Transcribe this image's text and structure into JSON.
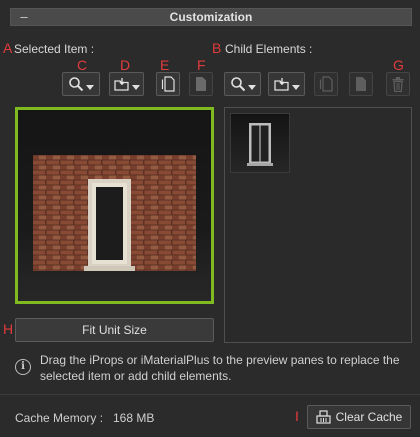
{
  "panel": {
    "title": "Customization",
    "collapse_glyph": "–"
  },
  "markers": {
    "a": "A",
    "b": "B",
    "c": "C",
    "d": "D",
    "e": "E",
    "f": "F",
    "g": "G",
    "h": "H",
    "i": "I"
  },
  "selected": {
    "label": "Selected Item :",
    "toolbar": [
      {
        "icon": "magnifier-icon",
        "dropdown": true,
        "enabled": true
      },
      {
        "icon": "folder-load-icon",
        "dropdown": true,
        "enabled": true
      },
      {
        "icon": "duplicate-icon",
        "dropdown": false,
        "enabled": true
      },
      {
        "icon": "document-icon",
        "dropdown": false,
        "enabled": false
      }
    ],
    "fit_button": "Fit Unit Size"
  },
  "child": {
    "label": "Child Elements :",
    "toolbar": [
      {
        "icon": "magnifier-icon",
        "dropdown": true,
        "enabled": true
      },
      {
        "icon": "folder-load-icon",
        "dropdown": true,
        "enabled": true
      },
      {
        "icon": "duplicate-icon",
        "dropdown": false,
        "enabled": false
      },
      {
        "icon": "document-icon",
        "dropdown": false,
        "enabled": false
      },
      {
        "icon": "trash-icon",
        "dropdown": false,
        "enabled": false
      }
    ]
  },
  "info": {
    "text": "Drag the iProps or iMaterialPlus to the preview panes to replace the selected item or add child elements."
  },
  "cache": {
    "label": "Cache Memory :",
    "value": "168 MB",
    "button": "Clear Cache"
  },
  "colors": {
    "accent_border": "#7fba20",
    "marker_red": "#e23b3b"
  }
}
